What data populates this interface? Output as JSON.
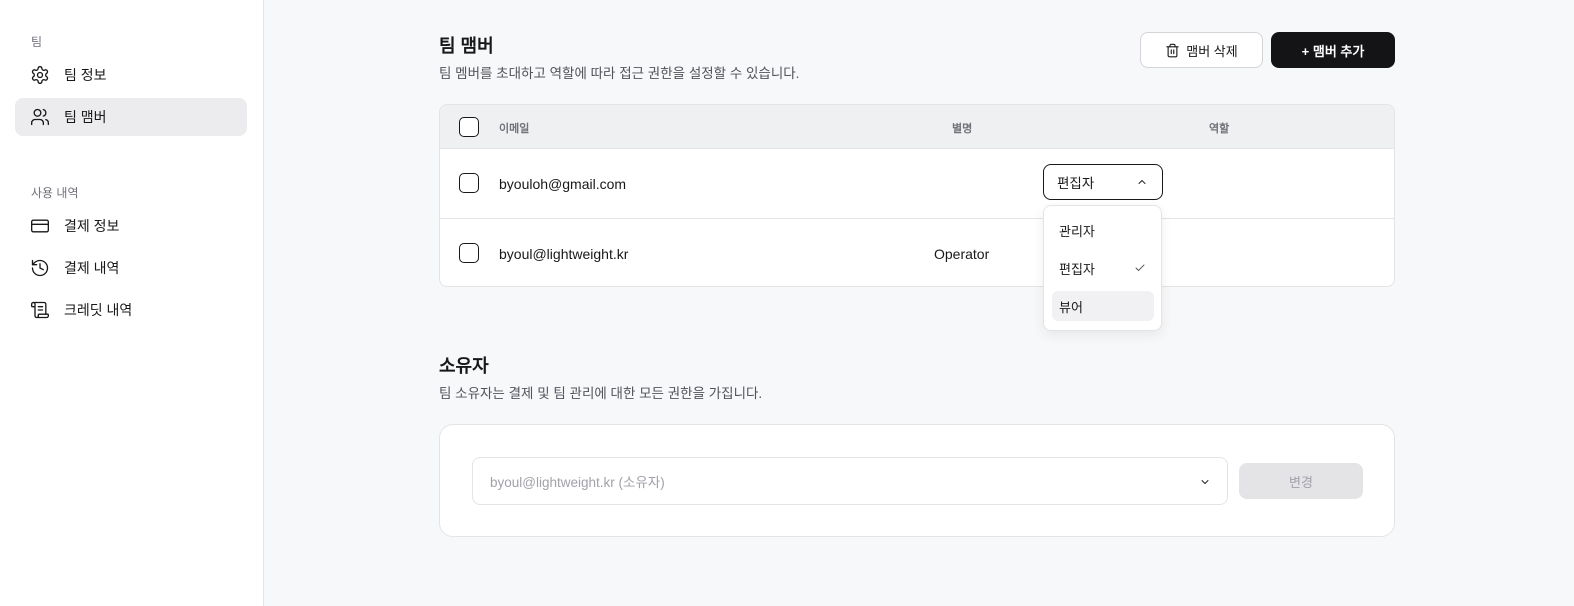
{
  "sidebar": {
    "sections": [
      {
        "label": "팀",
        "items": [
          {
            "label": "팀 정보",
            "icon": "gear-icon",
            "active": false
          },
          {
            "label": "팀 맴버",
            "icon": "users-icon",
            "active": true
          }
        ]
      },
      {
        "label": "사용 내역",
        "items": [
          {
            "label": "결제 정보",
            "icon": "credit-card-icon",
            "active": false
          },
          {
            "label": "결제 내역",
            "icon": "history-icon",
            "active": false
          },
          {
            "label": "크레딧 내역",
            "icon": "scroll-icon",
            "active": false
          }
        ]
      }
    ]
  },
  "members": {
    "title": "팀 맴버",
    "description": "팀 멤버를 초대하고 역할에 따라 접근 권한을 설정할 수 있습니다.",
    "delete_button": "맴버 삭제",
    "add_button": "+ 맴버 추가",
    "columns": [
      "이메일",
      "별명",
      "역할"
    ],
    "rows": [
      {
        "email": "byouloh@gmail.com",
        "nickname": "",
        "role": "편집자"
      },
      {
        "email": "byoul@lightweight.kr",
        "nickname": "Operator",
        "role": "뷰어"
      }
    ],
    "role_dropdown": {
      "open": true,
      "selected": "편집자",
      "options": [
        "관리자",
        "편집자",
        "뷰어"
      ],
      "highlighted": "뷰어"
    }
  },
  "owner": {
    "title": "소유자",
    "description": "팀 소유자는 결제 및 팀 관리에 대한 모든 권한을 가집니다.",
    "select_value": "byoul@lightweight.kr (소유자)",
    "change_button": "변경",
    "change_enabled": false
  },
  "colors": {
    "accent_dark": "#141416",
    "active_nav_bg": "#ececee",
    "disabled_bg": "#e4e4e7",
    "page_bg": "#f6f8fa"
  }
}
